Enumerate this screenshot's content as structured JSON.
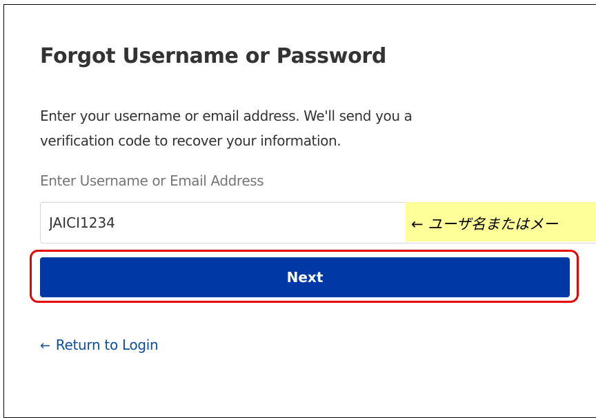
{
  "form": {
    "title": "Forgot Username or Password",
    "description": "Enter your username or email address. We'll send you a verification code to recover your information.",
    "field_label": "Enter Username or Email Address",
    "input_value": "JAICI1234",
    "next_label": "Next",
    "return_arrow": "←",
    "return_label": "Return to Login"
  },
  "annotation": {
    "text": "← ユーザ名またはメー"
  },
  "colors": {
    "primary_button": "#0039a6",
    "highlight_border": "#e60000",
    "annotation_bg": "#ffff99",
    "link": "#0b4f9c"
  }
}
